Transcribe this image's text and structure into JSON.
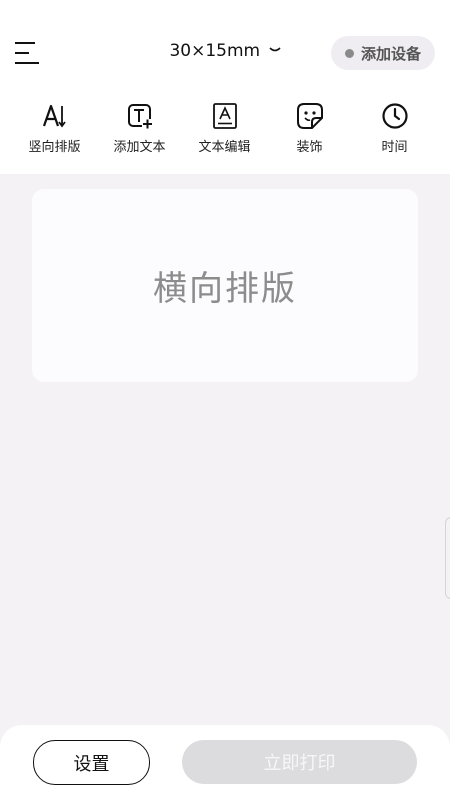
{
  "header": {
    "size_label": "30×15mm",
    "add_device_label": "添加设备"
  },
  "toolbar": {
    "items": [
      {
        "label": "竖向排版",
        "icon": "vertical-layout-icon"
      },
      {
        "label": "添加文本",
        "icon": "add-text-icon"
      },
      {
        "label": "文本编辑",
        "icon": "text-edit-icon"
      },
      {
        "label": "装饰",
        "icon": "sticker-icon"
      },
      {
        "label": "时间",
        "icon": "clock-icon"
      }
    ]
  },
  "canvas": {
    "text": "横向排版"
  },
  "bottom": {
    "settings_label": "设置",
    "print_label": "立即打印"
  },
  "colors": {
    "background": "#f4f2f4",
    "print_button_disabled": "#dcdbdd",
    "canvas_text": "#8c8c8c"
  }
}
